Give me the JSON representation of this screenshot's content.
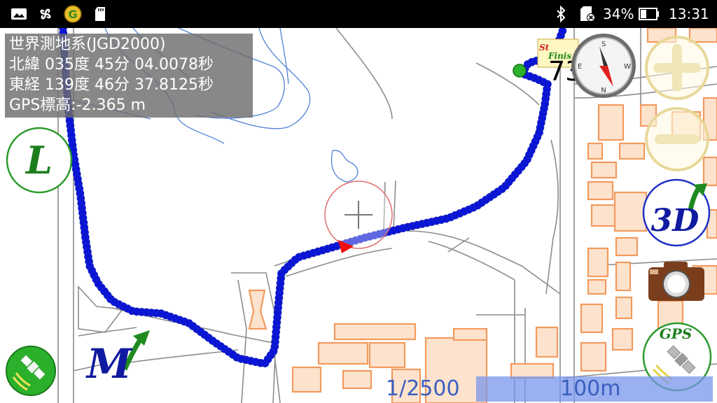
{
  "status_bar": {
    "battery_percent": "34%",
    "time": "13:31",
    "left_icons": [
      "gallery-icon",
      "pinwheel-icon",
      "app-badge-icon",
      "sd-card-icon"
    ],
    "right_icons": [
      "bluetooth-icon",
      "sim-card-icon",
      "battery-icon"
    ]
  },
  "coordinates": {
    "datum": "世界測地系(JGD2000)",
    "latitude": "北緯 035度 45分 04.0078秒",
    "longitude": "東経 139度 46分 37.8125秒",
    "gps_altitude": "GPS標高:-2.365 m"
  },
  "map": {
    "track_color": "#0a14d6",
    "road_color": "#8c8c8c",
    "building_color": "#f29a5e",
    "water_color": "#4f7fd6",
    "finish_flag_text": "Finis",
    "start_flag_text": "St",
    "partial_value": "73",
    "scale": "1/2500",
    "scale_bar_label": "100m"
  },
  "controls": {
    "l_button": "L",
    "m_button": "M",
    "three_d_button": "3D",
    "gps_button": "GPS",
    "zoom_in": "zoom-in-icon",
    "zoom_out": "zoom-out-icon",
    "compass": "compass-icon",
    "camera": "camera-icon",
    "satellite": "satellite-icon"
  }
}
